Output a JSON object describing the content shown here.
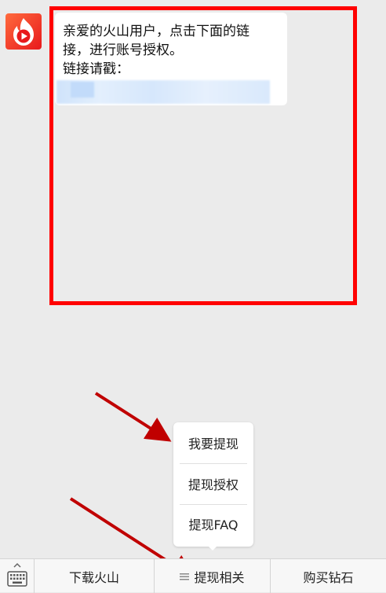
{
  "message": {
    "line1": "亲爱的火山用户，点击下面的链",
    "line2": "接，进行账号授权。",
    "line3": "链接请戳："
  },
  "popup_menu": {
    "items": [
      {
        "label": "我要提现"
      },
      {
        "label": "提现授权"
      },
      {
        "label": "提现FAQ"
      }
    ]
  },
  "bottom_menu": {
    "items": [
      {
        "label": "下载火山"
      },
      {
        "label": "提现相关"
      },
      {
        "label": "购买钻石"
      }
    ]
  },
  "colors": {
    "highlight_frame": "#ff0000",
    "arrow": "#c00000",
    "avatar_gradient_start": "#ff5a3c",
    "avatar_gradient_end": "#e8191c"
  },
  "icons": {
    "avatar": "hotsoon-flame-play-icon",
    "keyboard": "keyboard-icon",
    "menu_lines": "menu-lines-icon"
  }
}
